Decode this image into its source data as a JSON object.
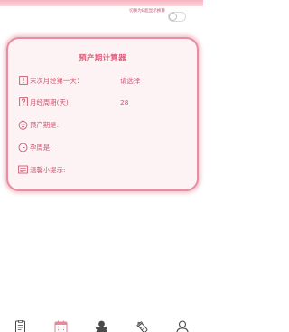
{
  "header": {
    "toggle_label": "切换为B超显示换算"
  },
  "card": {
    "title": "预产期计算器",
    "rows": [
      {
        "label": "末次月经第一天：",
        "value": "请选择"
      },
      {
        "label": "月经周期(天)：",
        "value": "28"
      },
      {
        "label": "预产期是:",
        "value": ""
      },
      {
        "label": "孕周是:",
        "value": ""
      },
      {
        "label": "温馨小提示:",
        "value": ""
      }
    ]
  },
  "tabbar": {
    "tabs": [
      {
        "icon": "document-icon"
      },
      {
        "icon": "calendar-icon"
      },
      {
        "icon": "baby-icon"
      },
      {
        "icon": "feeding-bottle-icon"
      },
      {
        "icon": "profile-icon"
      }
    ]
  },
  "colors": {
    "accent": "#e05d7b",
    "card_bg": "#fdf3f5",
    "card_border": "#e98ca0",
    "active_tab": "#e8879b"
  }
}
